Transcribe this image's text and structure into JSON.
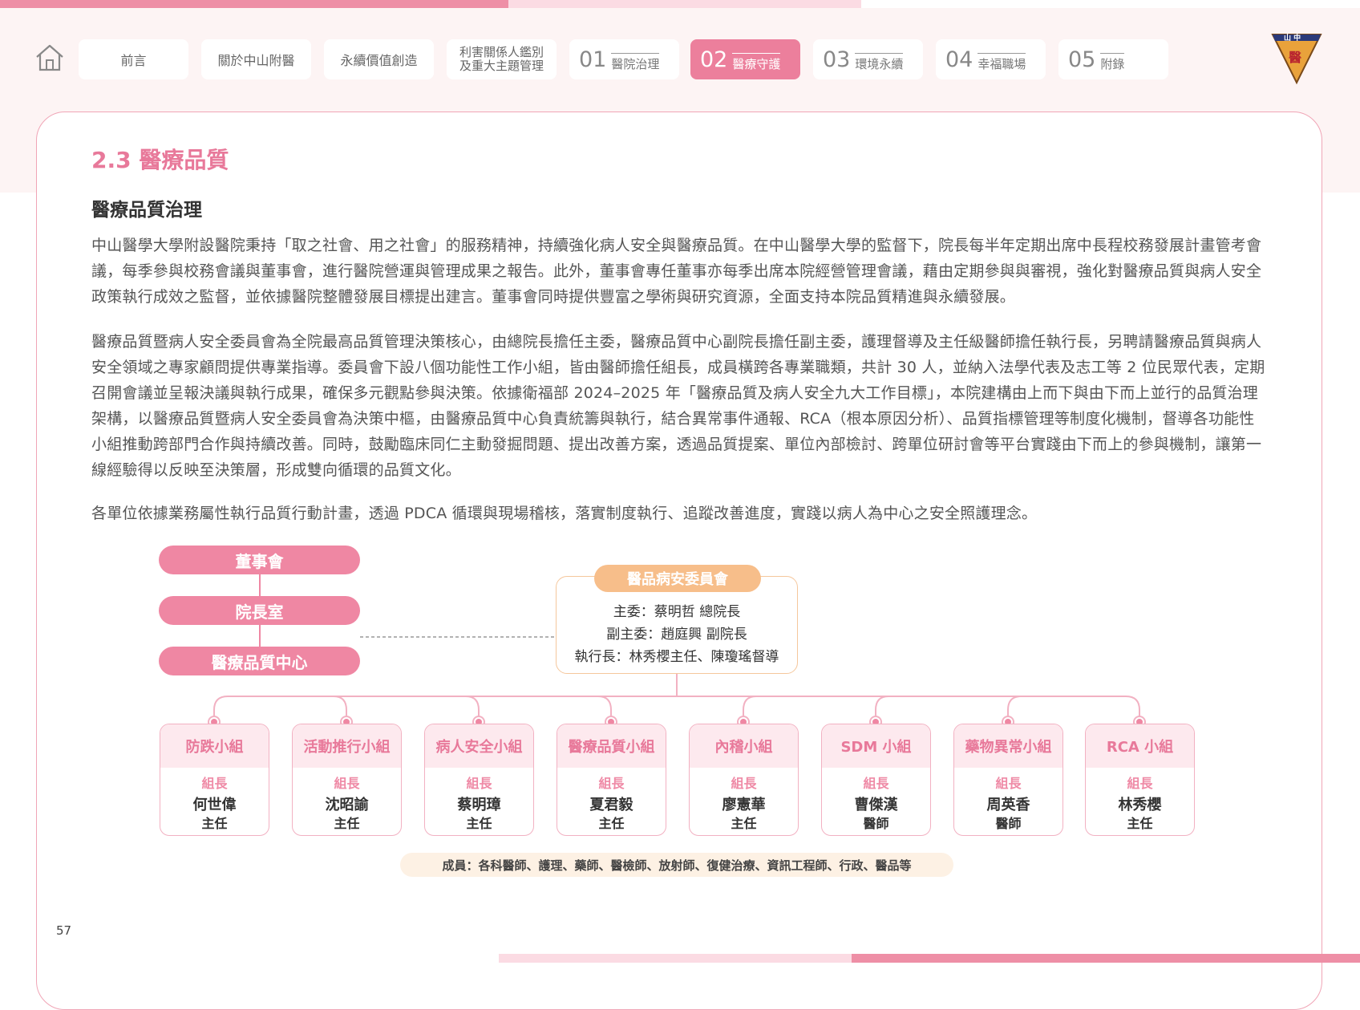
{
  "colors": {
    "accent_pink": "#ec7f9c",
    "light_pink": "#fde9ee",
    "accent_orange": "#f7be8a",
    "text": "#555555"
  },
  "nav": {
    "items": [
      {
        "label": "前言"
      },
      {
        "label": "關於中山附醫"
      },
      {
        "label": "永續價值創造"
      },
      {
        "label_line1": "利害關係人鑑別",
        "label_line2": "及重大主題管理"
      },
      {
        "num": "01",
        "label": "醫院治理"
      },
      {
        "num": "02",
        "label": "醫療守護",
        "active": true
      },
      {
        "num": "03",
        "label": "環境永續"
      },
      {
        "num": "04",
        "label": "幸福職場"
      },
      {
        "num": "05",
        "label": "附錄"
      }
    ]
  },
  "logo": {
    "top_text": "山 中",
    "bottom_text": "醫"
  },
  "content": {
    "section_title": "2.3 醫療品質",
    "sub_title": "醫療品質治理",
    "paragraphs": [
      "中山醫學大學附設醫院秉持「取之社會、用之社會」的服務精神，持續強化病人安全與醫療品質。在中山醫學大學的監督下，院長每半年定期出席中長程校務發展計畫管考會議，每季參與校務會議與董事會，進行醫院營運與管理成果之報告。此外，董事會專任董事亦每季出席本院經營管理會議，藉由定期參與與審視，強化對醫療品質與病人安全政策執行成效之監督，並依據醫院整體發展目標提出建言。董事會同時提供豐富之學術與研究資源，全面支持本院品質精進與永續發展。",
      "醫療品質暨病人安全委員會為全院最高品質管理決策核心，由總院長擔任主委，醫療品質中心副院長擔任副主委，護理督導及主任級醫師擔任執行長，另聘請醫療品質與病人安全領域之專家顧問提供專業指導。委員會下設八個功能性工作小組，皆由醫師擔任組長，成員橫跨各專業職類，共計 30 人，並納入法學代表及志工等 2 位民眾代表，定期召開會議並呈報決議與執行成果，確保多元觀點參與決策。依據衛福部 2024–2025 年「醫療品質及病人安全九大工作目標」，本院建構由上而下與由下而上並行的品質治理架構，以醫療品質暨病人安全委員會為決策中樞，由醫療品質中心負責統籌與執行，結合異常事件通報、RCA（根本原因分析）、品質指標管理等制度化機制，督導各功能性小組推動跨部門合作與持續改善。同時，鼓勵臨床同仁主動發掘問題、提出改善方案，透過品質提案、單位內部檢討、跨單位研討會等平台實踐由下而上的參與機制，讓第一線經驗得以反映至決策層，形成雙向循環的品質文化。",
      "各單位依據業務屬性執行品質行動計畫，透過 PDCA 循環與現場稽核，落實制度執行、追蹤改善進度，實踐以病人為中心之安全照護理念。"
    ]
  },
  "org_chart": {
    "hierarchy": [
      "董事會",
      "院長室",
      "醫療品質中心"
    ],
    "committee": {
      "title": "醫品病安委員會",
      "chair": "主委：蔡明哲 總院長",
      "vice_chair": "副主委：趙庭興 副院長",
      "executive": "執行長：林秀櫻主任、陳瓊瑤督導"
    },
    "groups": [
      {
        "name": "防跌小組",
        "role": "組長",
        "person": "何世偉",
        "title": "主任"
      },
      {
        "name": "活動推行小組",
        "role": "組長",
        "person": "沈昭諭",
        "title": "主任"
      },
      {
        "name": "病人安全小組",
        "role": "組長",
        "person": "蔡明璋",
        "title": "主任"
      },
      {
        "name": "醫療品質小組",
        "role": "組長",
        "person": "夏君毅",
        "title": "主任"
      },
      {
        "name": "內稽小組",
        "role": "組長",
        "person": "廖憲華",
        "title": "主任"
      },
      {
        "name": "SDM 小組",
        "role": "組長",
        "person": "曹傑漢",
        "title": "醫師"
      },
      {
        "name": "藥物異常小組",
        "role": "組長",
        "person": "周英香",
        "title": "醫師"
      },
      {
        "name": "RCA 小組",
        "role": "組長",
        "person": "林秀櫻",
        "title": "主任"
      }
    ],
    "members": "成員：各科醫師、護理、藥師、醫檢師、放射師、復健治療、資訊工程師、行政、醫品等"
  },
  "page_number": "57"
}
